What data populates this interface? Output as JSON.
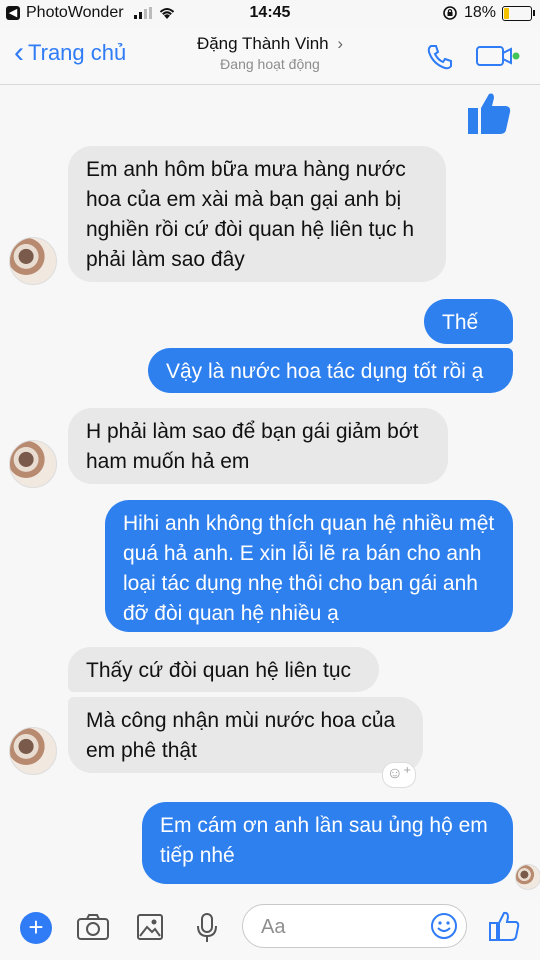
{
  "status_bar": {
    "carrier": "PhotoWonder",
    "time": "14:45",
    "battery_percent": "18%",
    "battery_level": 0.18,
    "battery_color": "#f2c200"
  },
  "header": {
    "back_label": "Trang chủ",
    "contact_name": "Đặng Thành Vinh",
    "contact_status": "Đang hoạt động",
    "name_chevron": "›",
    "icons": [
      "phone-icon",
      "video-call-icon"
    ]
  },
  "colors": {
    "accent": "#2f7cf6",
    "incoming_bubble": "#e8e8e8",
    "outgoing_bubble": "#2f80ef",
    "online_dot": "#43c45a"
  },
  "messages": [
    {
      "direction": "out",
      "type": "like-sticker"
    },
    {
      "direction": "in",
      "text": "Em anh hôm bữa mưa hàng nước hoa của em xài mà bạn gại anh bị nghiền rồi cứ đòi quan hệ liên tục h phải làm sao đây"
    },
    {
      "direction": "out",
      "text": "Thế ạ"
    },
    {
      "direction": "out",
      "text": "Vậy là nước hoa tác dụng tốt rồi ạ"
    },
    {
      "direction": "in",
      "text": "H phải làm sao để bạn gái giảm bớt ham muốn hả em"
    },
    {
      "direction": "out",
      "text": "Hihi anh không thích quan hệ nhiều mệt quá hả anh. E xin lỗi lẽ ra bán cho anh loại tác dụng nhẹ thôi cho bạn gái anh đỡ đòi quan hệ nhiều ạ"
    },
    {
      "direction": "in",
      "text": "Thấy cứ đòi quan hệ liên tục"
    },
    {
      "direction": "in",
      "text": "Mà công nhận mùi nước hoa của em phê thật"
    },
    {
      "direction": "out",
      "text": "Em cám ơn anh lần sau ủng hộ em tiếp nhé"
    }
  ],
  "composer": {
    "placeholder": "Aa",
    "icons": [
      "plus-icon",
      "camera-icon",
      "image-icon",
      "microphone-icon",
      "emoji-icon",
      "like-icon"
    ]
  }
}
